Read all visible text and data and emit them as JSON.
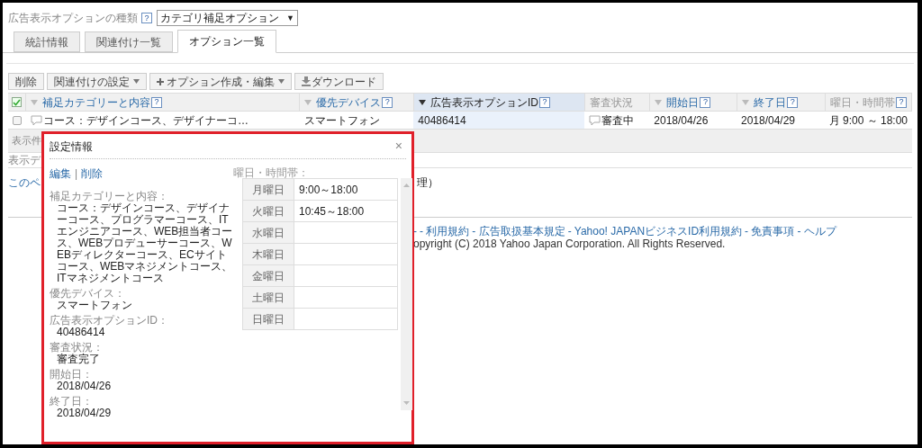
{
  "option_type": {
    "label": "広告表示オプションの種類",
    "help": "?",
    "value": "カテゴリ補足オプション",
    "caret": "▼"
  },
  "tabs": [
    {
      "label": "統計情報",
      "selected": false
    },
    {
      "label": "関連付け一覧",
      "selected": false
    },
    {
      "label": "オプション一覧",
      "selected": true
    }
  ],
  "toolbar": [
    {
      "label": "削除",
      "kind": "plain"
    },
    {
      "label": "関連付けの設定",
      "kind": "menu"
    },
    {
      "label": "オプション作成・編集",
      "kind": "create"
    },
    {
      "label": "ダウンロード",
      "kind": "download"
    }
  ],
  "table": {
    "select_all": {
      "checked": true
    },
    "columns": [
      {
        "label": "補足カテゴリーと内容",
        "help": "?",
        "sortable": true,
        "sorted": false
      },
      {
        "label": "優先デバイス",
        "help": "?",
        "sortable": true,
        "sorted": false
      },
      {
        "label": "広告表示オプションID",
        "help": "?",
        "sortable": true,
        "sorted": true
      },
      {
        "label": "審査状況",
        "sortable": false,
        "sorted": false
      },
      {
        "label": "開始日",
        "help": "?",
        "sortable": true,
        "sorted": false
      },
      {
        "label": "終了日",
        "help": "?",
        "sortable": true,
        "sorted": false
      },
      {
        "label": "曜日・時間帯",
        "help": "?",
        "sortable": false,
        "sorted": false
      }
    ],
    "rows": [
      {
        "checked": false,
        "cells": [
          {
            "text": "コース：デザインコース、デザイナーコ…",
            "kind": "note"
          },
          {
            "text": "スマートフォン",
            "kind": "plain"
          },
          {
            "text": "40486414",
            "kind": "plain"
          },
          {
            "text": "審査中",
            "kind": "note"
          },
          {
            "text": "2018/04/26",
            "kind": "plain"
          },
          {
            "text": "2018/04/29",
            "kind": "plain"
          },
          {
            "text": "月 9:00 ～ 18:00",
            "kind": "plain"
          }
        ]
      }
    ]
  },
  "page_size_label": "表示件",
  "data_label": "表示デ",
  "page_link": "このペ",
  "page_link_tail": "理）",
  "footer": {
    "links": [
      "-",
      "- 利用規約",
      "- 広告取扱基本規定",
      "- Yahoo! JAPANビジネスID利用規約",
      "- 免責事項",
      "- ヘルプ"
    ],
    "copyright": "opyright (C) 2018 Yahoo Japan Corporation. All Rights Reserved."
  },
  "popup": {
    "title": "設定情報",
    "close": "×",
    "actions": [
      "編集",
      "削除"
    ],
    "separator": "|",
    "fields": [
      {
        "label": "補足カテゴリーと内容：",
        "value": "コース：デザインコース、デザイナーコース、プログラマーコース、ITエンジニアコース、WEB担当者コース、WEBプロデューサーコース、WEBディレクターコース、ECサイトコース、WEBマネジメントコース、ITマネジメントコース"
      },
      {
        "label": "優先デバイス：",
        "value": "スマートフォン"
      },
      {
        "label": "広告表示オプションID：",
        "value": "40486414"
      },
      {
        "label": "審査状況：",
        "value": "審査完了"
      },
      {
        "label": "開始日：",
        "value": "2018/04/26"
      },
      {
        "label": "終了日：",
        "value": "2018/04/29"
      }
    ],
    "schedule_label": "曜日・時間帯：",
    "schedule": [
      {
        "day": "月曜日",
        "time": "9:00～18:00"
      },
      {
        "day": "火曜日",
        "time": "10:45～18:00"
      },
      {
        "day": "水曜日"
      },
      {
        "day": "木曜日"
      },
      {
        "day": "金曜日"
      },
      {
        "day": "土曜日"
      },
      {
        "day": "日曜日"
      }
    ]
  }
}
